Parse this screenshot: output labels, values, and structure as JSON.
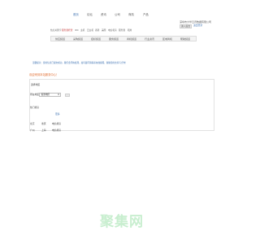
{
  "top_nav": [
    {
      "label": "首页",
      "active": true
    },
    {
      "label": "论坛",
      "active": false
    },
    {
      "label": "资讯",
      "active": false
    },
    {
      "label": "公司",
      "active": false
    },
    {
      "label": "商机",
      "active": false
    },
    {
      "label": "产品",
      "active": false
    }
  ],
  "account": {
    "company": "深圳市大华云讯数据有限公司",
    "primary_button": "进入后台",
    "secondary_link": "退出登录"
  },
  "sub_nav": [
    {
      "label": "热点关键字",
      "hot": false
    },
    {
      "label": "服务器托管",
      "hot": true
    },
    {
      "label": "IDC",
      "hot": false
    },
    {
      "label": "主机",
      "hot": false
    },
    {
      "label": "云主机",
      "hot": false
    },
    {
      "label": "香港",
      "hot": false
    },
    {
      "label": "美国",
      "hot": false
    },
    {
      "label": "电信机房",
      "hot": false
    },
    {
      "label": "服务器",
      "hot": false
    },
    {
      "label": "租用",
      "hot": false
    }
  ],
  "main_nav": [
    "供应频道",
    "采购频道",
    "招标频道",
    "服务频道",
    "商机频道",
    "行业资讯",
    "区域商机",
    "帮助频道"
  ],
  "notice": "温馨提示：您的信息已提交成功，我们会尽快处理，如有疑问请联系在线客服，谢谢您的支持与合作！",
  "greeting": "欢迎来到本站服务中心！",
  "panel": {
    "label_top": "选择地区",
    "label_field": "所在地区：",
    "select_value": "香港地区",
    "select_chevron": "chevron-down-icon",
    "label_list": "热门机房",
    "link_more": "更多",
    "rows": [
      [
        "北京",
        "重庆",
        "电信机房"
      ],
      [
        "广州",
        "上海",
        "电信机房"
      ]
    ]
  },
  "logo": "聚集网"
}
